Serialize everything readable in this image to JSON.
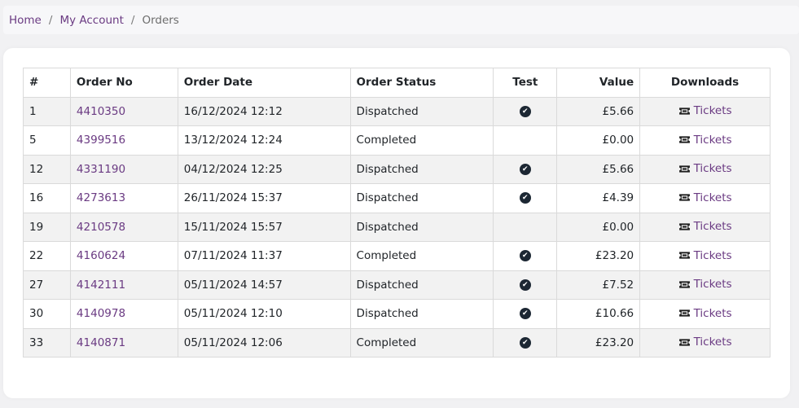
{
  "breadcrumb": {
    "items": [
      {
        "label": "Home"
      },
      {
        "label": "My Account"
      }
    ],
    "current": "Orders",
    "separator": "/"
  },
  "table": {
    "headers": {
      "num": "#",
      "order_no": "Order No",
      "order_date": "Order Date",
      "order_status": "Order Status",
      "test": "Test",
      "value": "Value",
      "downloads": "Downloads"
    },
    "rows": [
      {
        "num": "1",
        "order_no": "4410350",
        "order_date": "16/12/2024 12:12",
        "status": "Dispatched",
        "test": true,
        "value": "£5.66",
        "download": "Tickets"
      },
      {
        "num": "5",
        "order_no": "4399516",
        "order_date": "13/12/2024 12:24",
        "status": "Completed",
        "test": false,
        "value": "£0.00",
        "download": "Tickets"
      },
      {
        "num": "12",
        "order_no": "4331190",
        "order_date": "04/12/2024 12:25",
        "status": "Dispatched",
        "test": true,
        "value": "£5.66",
        "download": "Tickets"
      },
      {
        "num": "16",
        "order_no": "4273613",
        "order_date": "26/11/2024 15:37",
        "status": "Dispatched",
        "test": true,
        "value": "£4.39",
        "download": "Tickets"
      },
      {
        "num": "19",
        "order_no": "4210578",
        "order_date": "15/11/2024 15:57",
        "status": "Dispatched",
        "test": false,
        "value": "£0.00",
        "download": "Tickets"
      },
      {
        "num": "22",
        "order_no": "4160624",
        "order_date": "07/11/2024 11:37",
        "status": "Completed",
        "test": true,
        "value": "£23.20",
        "download": "Tickets"
      },
      {
        "num": "27",
        "order_no": "4142111",
        "order_date": "05/11/2024 14:57",
        "status": "Dispatched",
        "test": true,
        "value": "£7.52",
        "download": "Tickets"
      },
      {
        "num": "30",
        "order_no": "4140978",
        "order_date": "05/11/2024 12:10",
        "status": "Dispatched",
        "test": true,
        "value": "£10.66",
        "download": "Tickets"
      },
      {
        "num": "33",
        "order_no": "4140871",
        "order_date": "05/11/2024 12:06",
        "status": "Completed",
        "test": true,
        "value": "£23.20",
        "download": "Tickets"
      }
    ]
  },
  "icons": {
    "test_icon": "check-circle-icon",
    "download_icon": "ticket-icon"
  },
  "colors": {
    "link": "#6a3a82",
    "check_badge": "#1c2733",
    "stripe": "#f2f2f2"
  }
}
